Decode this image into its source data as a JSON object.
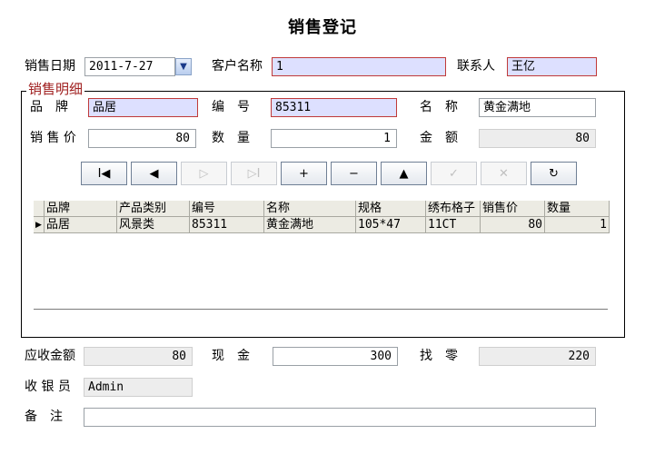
{
  "title": "销售登记",
  "header": {
    "date_label": "销售日期",
    "date_value": "2011-7-27",
    "customer_label": "客户名称",
    "customer_value": "1",
    "contact_label": "联系人",
    "contact_value": "王亿"
  },
  "detail": {
    "legend": "销售明细",
    "brand_label": "品　牌",
    "brand_value": "品居",
    "code_label": "编　号",
    "code_value": "85311",
    "name_label": "名　称",
    "name_value": "黄金满地",
    "price_label": "销 售 价",
    "price_value": "80",
    "qty_label": "数　量",
    "qty_value": "1",
    "amount_label": "金　额",
    "amount_value": "80"
  },
  "navigator": {
    "buttons": [
      {
        "name": "first-record-button",
        "glyph": "I◀",
        "enabled": true
      },
      {
        "name": "prior-record-button",
        "glyph": "◀",
        "enabled": true
      },
      {
        "name": "next-record-button",
        "glyph": "▷",
        "enabled": false
      },
      {
        "name": "last-record-button",
        "glyph": "▷I",
        "enabled": false
      },
      {
        "name": "insert-record-button",
        "glyph": "+",
        "enabled": true
      },
      {
        "name": "delete-record-button",
        "glyph": "−",
        "enabled": true
      },
      {
        "name": "edit-record-button",
        "glyph": "▲",
        "enabled": true
      },
      {
        "name": "post-record-button",
        "glyph": "✓",
        "enabled": false
      },
      {
        "name": "cancel-record-button",
        "glyph": "✕",
        "enabled": false
      },
      {
        "name": "refresh-record-button",
        "glyph": "↻",
        "enabled": true
      }
    ]
  },
  "grid": {
    "columns": [
      "品牌",
      "产品类别",
      "编号",
      "名称",
      "规格",
      "绣布格子",
      "销售价",
      "数量"
    ],
    "rows": [
      [
        "品居",
        "风景类",
        "85311",
        "黄金满地",
        "105*47",
        "11CT",
        "80",
        "1"
      ]
    ]
  },
  "footer": {
    "receivable_label": "应收金额",
    "receivable_value": "80",
    "cash_label": "现　金",
    "cash_value": "300",
    "change_label": "找　零",
    "change_value": "220",
    "cashier_label": "收 银 员",
    "cashier_value": "Admin",
    "remark_label": "备　注",
    "remark_value": ""
  },
  "colors": {
    "highlight_bg": "#dde0ff",
    "highlight_border": "#c03a3a",
    "legend_color": "#a02020",
    "readonly_bg": "#ededed"
  }
}
